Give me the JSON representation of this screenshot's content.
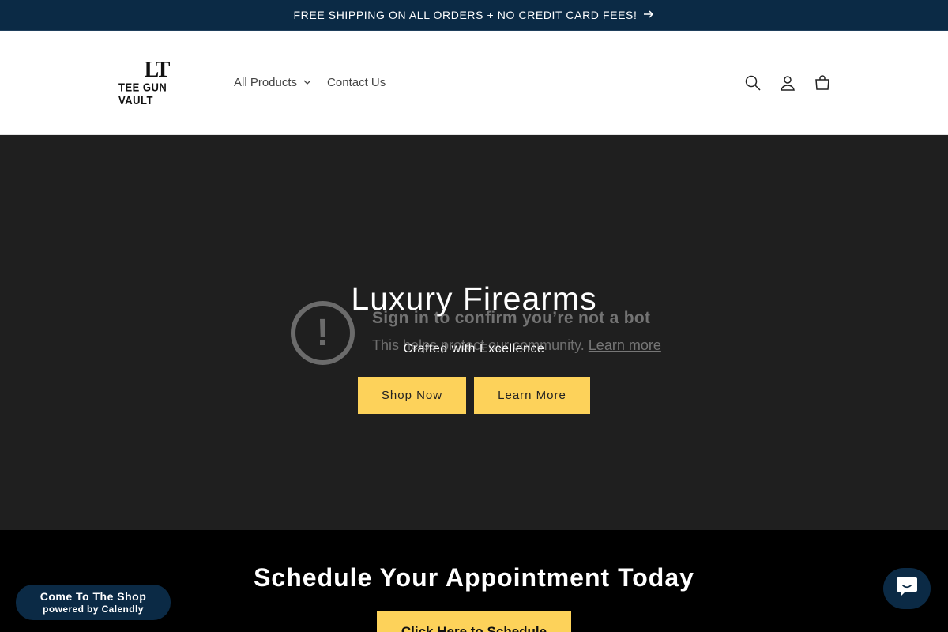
{
  "announcement": {
    "text": "FREE SHIPPING ON ALL ORDERS + NO CREDIT CARD FEES!",
    "arrow_icon": "arrow-right-icon"
  },
  "header": {
    "logo": {
      "mark": "LT",
      "text": "TEE GUN VAULT"
    },
    "nav": [
      {
        "label": "All Products",
        "has_dropdown": true
      },
      {
        "label": "Contact Us"
      }
    ],
    "icons": [
      "search-icon",
      "account-icon",
      "cart-icon"
    ]
  },
  "hero": {
    "title": "Luxury Firearms",
    "subtitle": "Crafted with Excellence",
    "buttons": {
      "shop_now": "Shop Now",
      "learn_more": "Learn More"
    }
  },
  "bot_overlay": {
    "title": "Sign in to confirm you’re not a bot",
    "description": "This helps protect our community.",
    "link": "Learn more"
  },
  "schedule": {
    "title": "Schedule Your Appointment Today",
    "button": "Click Here to Schedule"
  },
  "calendly": {
    "line1": "Come To The Shop",
    "line2": "powered by Calendly"
  },
  "colors": {
    "announce_bg": "#0b2a45",
    "hero_bg": "#1f1f1f",
    "accent": "#fdd25a",
    "schedule_bg": "#000000"
  }
}
